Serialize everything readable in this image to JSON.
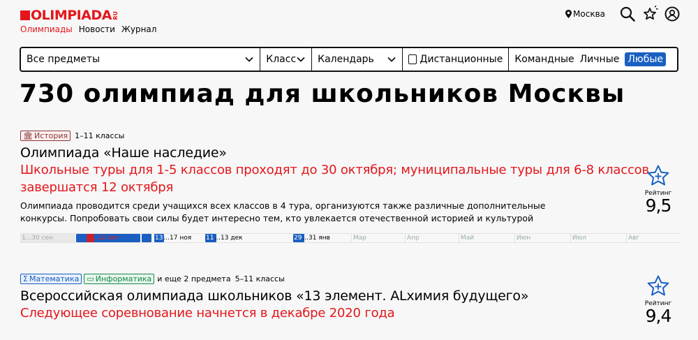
{
  "header": {
    "logo_text": "OLIMPIADA",
    "logo_suffix": "RU",
    "nav": [
      "Олимпиады",
      "Новости",
      "Журнал"
    ],
    "city": "Москва"
  },
  "filters": {
    "subject": "Все предметы",
    "class": "Класс",
    "calendar": "Календарь",
    "distance": "Дистанционные",
    "types": [
      "Командные",
      "Личные",
      "Любые"
    ],
    "selected_type": "Любые"
  },
  "page_title": "730 олимпиад для школьников Москвы",
  "olympiads": [
    {
      "tags": [
        {
          "label": "История",
          "kind": "history"
        }
      ],
      "extra": "",
      "classes": "1–11 классы",
      "name": "Олимпиада «Наше наследие»",
      "news": "Школьные туры для 1-5 классов проходят до 30 октября; муниципальные туры для 6-8 классов завершатся 12 октября",
      "description": "Олимпиада проводится среди учащихся всех классов в 4 тура, организуются также различные дополнительные конкурсы. Попробовать свои силы будет интересно тем, кто увлекается отечественной историей и культурой",
      "rating_label": "Рейтинг",
      "rating": "9,5",
      "timeline": {
        "past_label": "1...30 сен",
        "labels": [
          {
            "num": "7",
            "text": "...12 окт"
          },
          {
            "num": "13",
            "text": "...17 ноя"
          },
          {
            "num": "11",
            "text": "...13 дек"
          },
          {
            "num": "29",
            "text": "...31 янв"
          }
        ],
        "months": [
          "Мар",
          "Апр",
          "Май",
          "Июн",
          "Июл",
          "Авг"
        ]
      }
    },
    {
      "tags": [
        {
          "label": "Математика",
          "kind": "math"
        },
        {
          "label": "Информатика",
          "kind": "info"
        }
      ],
      "extra": "и еще 2 предмета",
      "classes": "5–11 классы",
      "name": "Всероссийская олимпиада школьников «13 элемент. ALхимия будущего»",
      "news": "Следующее соревнование начнется в декабре 2020 года",
      "rating_label": "Рейтинг",
      "rating": "9,4"
    }
  ],
  "colors": {
    "brand_red": "#e4161b",
    "accent_blue": "#1a5fc1"
  }
}
